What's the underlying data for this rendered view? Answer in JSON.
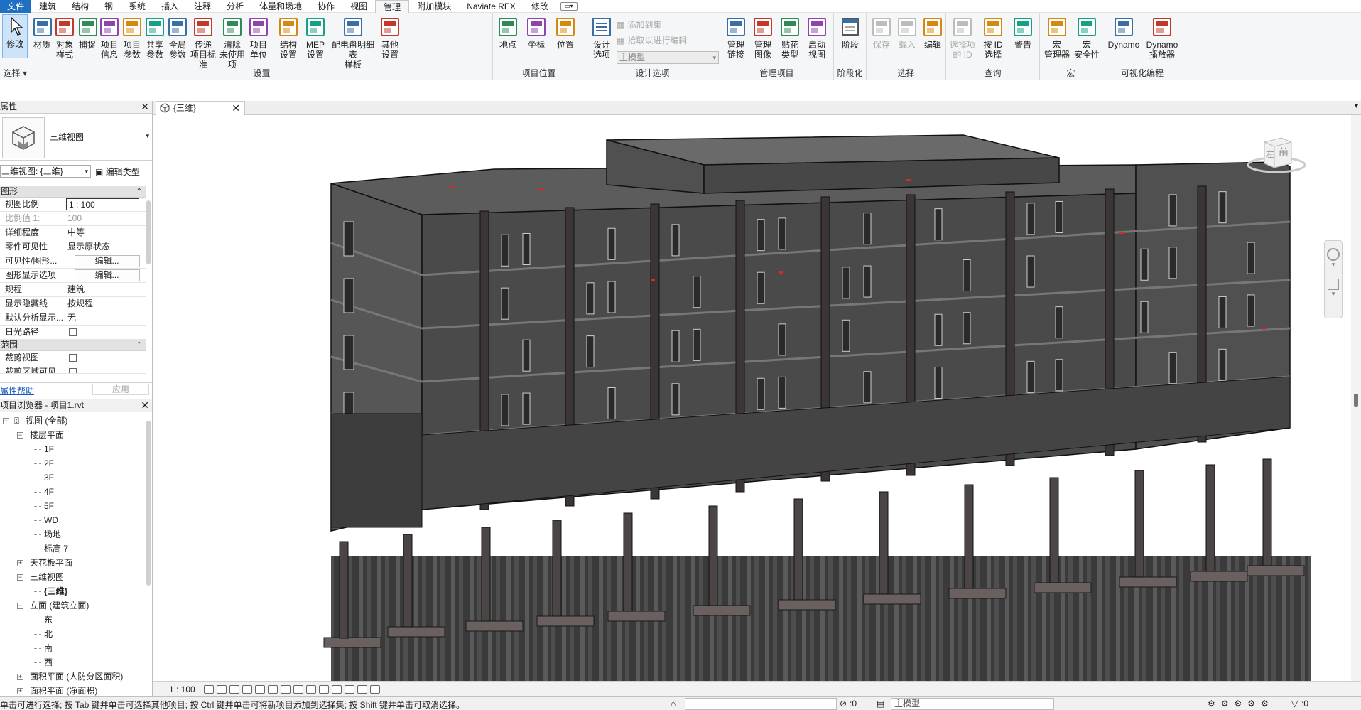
{
  "menu": {
    "items": [
      "文件",
      "建筑",
      "结构",
      "钢",
      "系统",
      "插入",
      "注释",
      "分析",
      "体量和场地",
      "协作",
      "视图",
      "管理",
      "附加模块",
      "Naviate REX",
      "修改"
    ],
    "active": "管理"
  },
  "ribbon": {
    "select": {
      "modify_label": "修改",
      "panel_title": "选择"
    },
    "settings": {
      "panel_title": "设置",
      "buttons": [
        {
          "line1": "材质",
          "line2": ""
        },
        {
          "line1": "对象",
          "line2": "样式"
        },
        {
          "line1": "捕捉",
          "line2": ""
        },
        {
          "line1": "项目",
          "line2": "信息"
        },
        {
          "line1": "项目",
          "line2": "参数"
        },
        {
          "line1": "共享",
          "line2": "参数"
        },
        {
          "line1": "全局",
          "line2": "参数"
        },
        {
          "line1": "传递",
          "line2": "项目标准"
        },
        {
          "line1": "清除",
          "line2": "未使用项"
        },
        {
          "line1": "项目",
          "line2": "单位"
        },
        {
          "line1": "结构",
          "line2": "设置"
        },
        {
          "line1": "MEP",
          "line2": "设置"
        },
        {
          "line1": "配电盘明细表",
          "line2": "样板"
        },
        {
          "line1": "其他",
          "line2": "设置"
        }
      ]
    },
    "location": {
      "panel_title": "项目位置",
      "buttons": [
        {
          "line1": "地点",
          "line2": ""
        },
        {
          "line1": "坐标",
          "line2": ""
        },
        {
          "line1": "位置",
          "line2": ""
        }
      ]
    },
    "design_options": {
      "panel_title": "设计选项",
      "button": {
        "line1": "设计",
        "line2": "选项"
      },
      "add_to_set": "添加到集",
      "pick_to_edit": "拾取以进行编辑",
      "main_model": "主模型"
    },
    "manage_project": {
      "panel_title": "管理项目",
      "buttons": [
        {
          "line1": "管理",
          "line2": "链接"
        },
        {
          "line1": "管理",
          "line2": "图像"
        },
        {
          "line1": "贴花",
          "line2": "类型"
        },
        {
          "line1": "启动",
          "line2": "视图"
        }
      ]
    },
    "phasing": {
      "panel_title": "阶段化",
      "button": "阶段"
    },
    "selection": {
      "panel_title": "选择",
      "buttons": [
        {
          "line1": "保存",
          "line2": ""
        },
        {
          "line1": "载入",
          "line2": ""
        },
        {
          "line1": "编辑",
          "line2": ""
        }
      ]
    },
    "inquiry": {
      "panel_title": "查询",
      "buttons": [
        {
          "line1": "选择项",
          "line2": "的 ID"
        },
        {
          "line1": "按 ID",
          "line2": "选择"
        },
        {
          "line1": "警告",
          "line2": ""
        }
      ]
    },
    "macros": {
      "panel_title": "宏",
      "buttons": [
        {
          "line1": "宏",
          "line2": "管理器"
        },
        {
          "line1": "宏",
          "line2": "安全性"
        }
      ]
    },
    "visual_programming": {
      "panel_title": "可视化编程",
      "buttons": [
        {
          "line1": "Dynamo",
          "line2": ""
        },
        {
          "line1": "Dynamo",
          "line2": "播放器"
        }
      ]
    }
  },
  "properties": {
    "title": "属性",
    "type_name": "三维视图",
    "view_selector": "三维视图: {三维}",
    "edit_type": "编辑类型",
    "sections": {
      "graphics": "图形",
      "extents": "范围"
    },
    "rows": [
      {
        "name": "视图比例",
        "value": "1 : 100"
      },
      {
        "name": "比例值 1:",
        "value": "100"
      },
      {
        "name": "详细程度",
        "value": "中等"
      },
      {
        "name": "零件可见性",
        "value": "显示原状态"
      },
      {
        "name": "可见性/图形...",
        "value": "编辑..."
      },
      {
        "name": "图形显示选项",
        "value": "编辑..."
      },
      {
        "name": "规程",
        "value": "建筑"
      },
      {
        "name": "显示隐藏线",
        "value": "按规程"
      },
      {
        "name": "默认分析显示...",
        "value": "无"
      },
      {
        "name": "日光路径",
        "value": ""
      },
      {
        "name": "裁剪视图",
        "value": ""
      },
      {
        "name": "裁剪区域可见",
        "value": ""
      }
    ],
    "help": "属性帮助",
    "apply": "应用"
  },
  "browser": {
    "title": "项目浏览器 - 项目1.rvt",
    "nodes": [
      {
        "label": "视图 (全部)"
      },
      {
        "label": "楼层平面"
      },
      {
        "label": "1F"
      },
      {
        "label": "2F"
      },
      {
        "label": "3F"
      },
      {
        "label": "4F"
      },
      {
        "label": "5F"
      },
      {
        "label": "WD"
      },
      {
        "label": "场地"
      },
      {
        "label": "标高 7"
      },
      {
        "label": "天花板平面"
      },
      {
        "label": "三维视图"
      },
      {
        "label": "{三维}"
      },
      {
        "label": "立面 (建筑立面)"
      },
      {
        "label": "东"
      },
      {
        "label": "北"
      },
      {
        "label": "南"
      },
      {
        "label": "西"
      },
      {
        "label": "面积平面 (人防分区面积)"
      },
      {
        "label": "面积平面 (净面积)"
      }
    ]
  },
  "view": {
    "tab_label": "{三维}",
    "viewcube_left": "左",
    "viewcube_front": "前",
    "scale": "1 : 100"
  },
  "status": {
    "text": "单击可进行选择; 按 Tab 键并单击可选择其他项目; 按 Ctrl 键并单击可将新项目添加到选择集; 按 Shift 键并单击可取消选择。",
    "count": ":0",
    "model": "主模型",
    "filter_count": ":0"
  },
  "colors": {
    "file_tab": "#1f6fc2",
    "building": "#4a4a4a",
    "accent_red": "#d42a2a"
  }
}
